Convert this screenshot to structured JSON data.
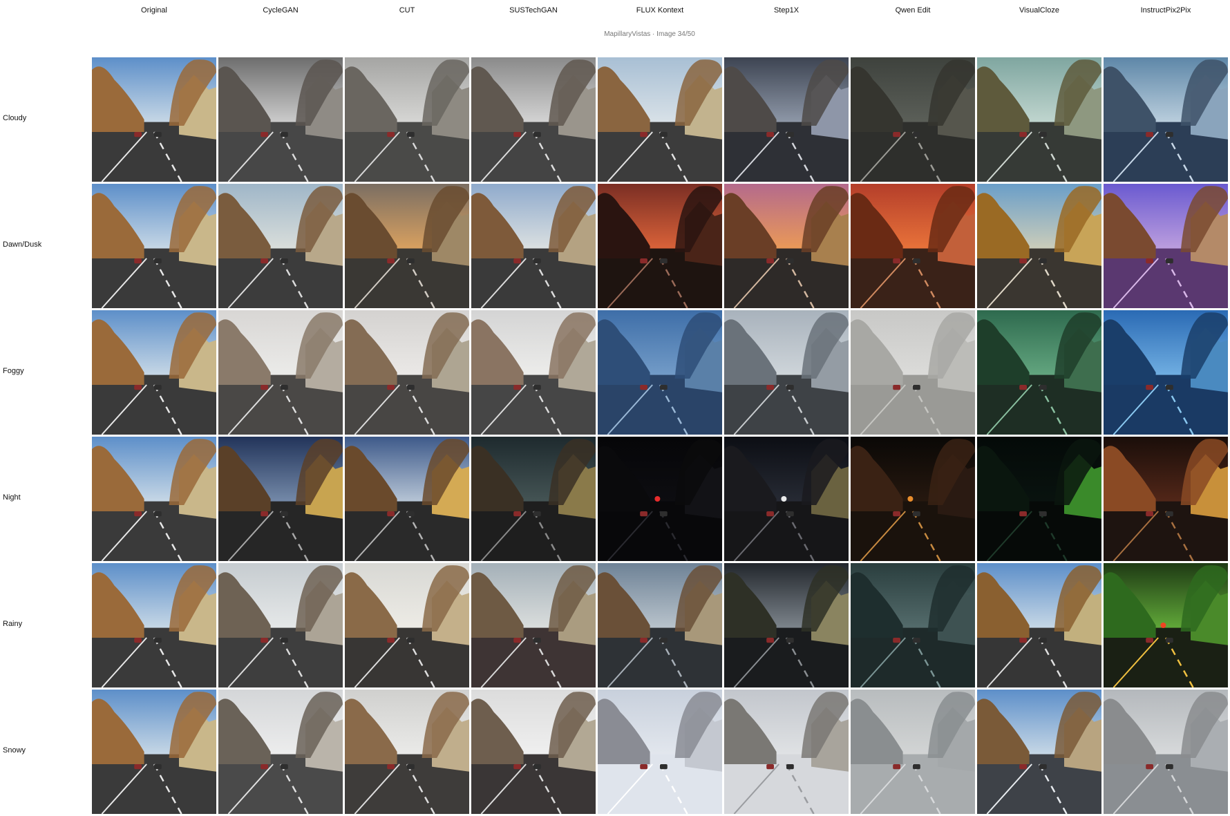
{
  "subtitle": "MapillaryVistas · Image 34/50",
  "columns": [
    {
      "label": "Original",
      "style": "orig"
    },
    {
      "label": "CycleGAN",
      "style": "cyclegan"
    },
    {
      "label": "CUT",
      "style": "cut"
    },
    {
      "label": "SUSTechGAN",
      "style": "sustech"
    },
    {
      "label": "FLUX Kontext",
      "style": "flux"
    },
    {
      "label": "Step1X",
      "style": "step1x"
    },
    {
      "label": "Qwen Edit",
      "style": "qwen"
    },
    {
      "label": "VisualCloze",
      "style": "visualcloze"
    },
    {
      "label": "InstructPix2Pix",
      "style": "ip2p"
    }
  ],
  "rows": [
    {
      "label": "Cloudy",
      "key": "cloudy"
    },
    {
      "label": "Dawn/Dusk",
      "key": "dusk"
    },
    {
      "label": "Foggy",
      "key": "foggy"
    },
    {
      "label": "Night",
      "key": "night"
    },
    {
      "label": "Rainy",
      "key": "rainy"
    },
    {
      "label": "Snowy",
      "key": "snowy"
    }
  ],
  "palettes": {
    "orig": {
      "sky1": "#5d8fc9",
      "sky2": "#d6e2ea",
      "tree": "#9a6a3a",
      "bld": "#c9b78a",
      "road": "#3a3a3a",
      "mark": "#e8e8e8",
      "light": ""
    }
  },
  "cell_palettes": {
    "cloudy": {
      "orig": {
        "sky1": "#5d8fc9",
        "sky2": "#d6e2ea",
        "tree": "#9a6a3a",
        "bld": "#c9b78a",
        "road": "#3a3a3a",
        "mark": "#e8e8e8"
      },
      "cyclegan": {
        "sky1": "#6d6d6d",
        "sky2": "#d9d9d9",
        "tree": "#5a5550",
        "bld": "#8f8b85",
        "road": "#474747",
        "mark": "#dcdcdc"
      },
      "cut": {
        "sky1": "#a5a5a3",
        "sky2": "#dddddb",
        "tree": "#6a6660",
        "bld": "#8e8a82",
        "road": "#4a4a48",
        "mark": "#d8d8d8"
      },
      "sustech": {
        "sky1": "#8a8a8a",
        "sky2": "#dedede",
        "tree": "#605850",
        "bld": "#9a958c",
        "road": "#444444",
        "mark": "#dddddd"
      },
      "flux": {
        "sky1": "#a8bfd4",
        "sky2": "#dfe6ea",
        "tree": "#8a6540",
        "bld": "#c2b38e",
        "road": "#3c3c3c",
        "mark": "#e4e4e4"
      },
      "step1x": {
        "sky1": "#3d4452",
        "sky2": "#9aa4b4",
        "tree": "#4e4a48",
        "bld": "#8e96a8",
        "road": "#2e3036",
        "mark": "#d4d6dc"
      },
      "qwen": {
        "sky1": "#3e423d",
        "sky2": "#5f635c",
        "tree": "#35352f",
        "bld": "#56564d",
        "road": "#2e2f2c",
        "mark": "#9c9c96"
      },
      "visualcloze": {
        "sky1": "#7fa6a0",
        "sky2": "#c9dcd5",
        "tree": "#5e5a3c",
        "bld": "#8e9880",
        "road": "#363a36",
        "mark": "#d0d8d2"
      },
      "ip2p": {
        "sky1": "#5e87a8",
        "sky2": "#c7d8e4",
        "tree": "#3e5268",
        "bld": "#8aa4bc",
        "road": "#2c3e56",
        "mark": "#c8d8e8"
      }
    },
    "dusk": {
      "orig": {
        "sky1": "#5d8fc9",
        "sky2": "#d6e2ea",
        "tree": "#9a6a3a",
        "bld": "#c9b78a",
        "road": "#3a3a3a",
        "mark": "#e8e8e8"
      },
      "cyclegan": {
        "sky1": "#9fb6c8",
        "sky2": "#e2e4de",
        "tree": "#7a5c3e",
        "bld": "#b8a88a",
        "road": "#3c3c3c",
        "mark": "#dcdcdc"
      },
      "cut": {
        "sky1": "#7a6e62",
        "sky2": "#e6a860",
        "tree": "#6a4c30",
        "bld": "#9e8866",
        "road": "#3a3834",
        "mark": "#d2ccc4"
      },
      "sustech": {
        "sky1": "#8faacc",
        "sky2": "#e6e8e4",
        "tree": "#7e5a3a",
        "bld": "#b4a282",
        "road": "#3a3a3a",
        "mark": "#dcdcdc"
      },
      "flux": {
        "sky1": "#7a2e24",
        "sky2": "#e86a3c",
        "tree": "#2a1410",
        "bld": "#4a2418",
        "road": "#1e1410",
        "mark": "#9a6a58"
      },
      "step1x": {
        "sky1": "#b46a8c",
        "sky2": "#f2a050",
        "tree": "#6a3e26",
        "bld": "#a8804e",
        "road": "#2e2a28",
        "mark": "#d4b8a0"
      },
      "qwen": {
        "sky1": "#b43e2a",
        "sky2": "#f07a3c",
        "tree": "#6a2a14",
        "bld": "#c2603a",
        "road": "#3a2218",
        "mark": "#d08a60"
      },
      "visualcloze": {
        "sky1": "#6a9ec8",
        "sky2": "#dad4b8",
        "tree": "#9a6a24",
        "bld": "#c8a458",
        "road": "#3a3630",
        "mark": "#e0d8c8"
      },
      "ip2p": {
        "sky1": "#6a5ad0",
        "sky2": "#c8a8e0",
        "tree": "#7a4a30",
        "bld": "#b48a68",
        "road": "#5a3870",
        "mark": "#d8b8e8"
      }
    },
    "foggy": {
      "orig": {
        "sky1": "#5d8fc9",
        "sky2": "#d6e2ea",
        "tree": "#9a6a3a",
        "bld": "#c9b78a",
        "road": "#3a3a3a",
        "mark": "#e8e8e8"
      },
      "cyclegan": {
        "sky1": "#d8d6d4",
        "sky2": "#eeeeec",
        "tree": "#8a7a6a",
        "bld": "#b4aca0",
        "road": "#4a4846",
        "mark": "#dedede"
      },
      "cut": {
        "sky1": "#d4d2d0",
        "sky2": "#eeecea",
        "tree": "#846c54",
        "bld": "#aea592",
        "road": "#484644",
        "mark": "#dcdcdc"
      },
      "sustech": {
        "sky1": "#d4d4d4",
        "sky2": "#f0f0ee",
        "tree": "#8a7462",
        "bld": "#b0a898",
        "road": "#464646",
        "mark": "#dcdcdc"
      },
      "flux": {
        "sky1": "#3e6ea8",
        "sky2": "#7aa2cc",
        "tree": "#2e4e78",
        "bld": "#5a80a8",
        "road": "#2a4468",
        "mark": "#9ab8d6"
      },
      "step1x": {
        "sky1": "#a8b2bc",
        "sky2": "#d4dade",
        "tree": "#6a727a",
        "bld": "#949ca4",
        "road": "#3e4246",
        "mark": "#c8cccf"
      },
      "qwen": {
        "sky1": "#c8c8c6",
        "sky2": "#dededc",
        "tree": "#a8a8a4",
        "bld": "#bcbcb8",
        "road": "#9a9a96",
        "mark": "#c6c6c2"
      },
      "visualcloze": {
        "sky1": "#2e6a4e",
        "sky2": "#6aae86",
        "tree": "#1e3e2a",
        "bld": "#3e6e4e",
        "road": "#1e2e24",
        "mark": "#8ac0a0"
      },
      "ip2p": {
        "sky1": "#2a6ab4",
        "sky2": "#7ab8e8",
        "tree": "#1a3e6a",
        "bld": "#4a8ac0",
        "road": "#1a3a64",
        "mark": "#8ac8f0"
      }
    },
    "night": {
      "orig": {
        "sky1": "#5d8fc9",
        "sky2": "#d6e2ea",
        "tree": "#9a6a3a",
        "bld": "#c9b78a",
        "road": "#3a3a3a",
        "mark": "#e8e8e8"
      },
      "cyclegan": {
        "sky1": "#22345a",
        "sky2": "#8096b4",
        "tree": "#5a4028",
        "bld": "#c8a450",
        "road": "#262626",
        "mark": "#a8a8a8"
      },
      "cut": {
        "sky1": "#3e5a8a",
        "sky2": "#c8d4e0",
        "tree": "#6a4a2c",
        "bld": "#d4aa54",
        "road": "#2a2a2a",
        "mark": "#b4b4b4"
      },
      "sustech": {
        "sky1": "#1e2a2e",
        "sky2": "#4a5a5a",
        "tree": "#3a3024",
        "bld": "#8a7a4a",
        "road": "#1e1e1e",
        "mark": "#8a8a8a"
      },
      "flux": {
        "sky1": "#060608",
        "sky2": "#0e0e12",
        "tree": "#0a0a0c",
        "bld": "#121216",
        "road": "#08080a",
        "mark": "#2a2a30",
        "light": "#ff3030"
      },
      "step1x": {
        "sky1": "#0c0e14",
        "sky2": "#2a2e38",
        "tree": "#1a1a1e",
        "bld": "#6a6240",
        "road": "#161618",
        "mark": "#6a6a70",
        "light": "#ffffff"
      },
      "qwen": {
        "sky1": "#0a0806",
        "sky2": "#2a1a10",
        "tree": "#3a2214",
        "bld": "#2a1a12",
        "road": "#1a120c",
        "mark": "#c88a40",
        "light": "#ff9a30"
      },
      "visualcloze": {
        "sky1": "#040a08",
        "sky2": "#0a1410",
        "tree": "#0a160e",
        "bld": "#3a8a2a",
        "road": "#060a08",
        "mark": "#1e3a2a"
      },
      "ip2p": {
        "sky1": "#1a0e0a",
        "sky2": "#5a2a1a",
        "tree": "#8a4a24",
        "bld": "#c8903a",
        "road": "#1e1410",
        "mark": "#a87040"
      }
    },
    "rainy": {
      "orig": {
        "sky1": "#5d8fc9",
        "sky2": "#d6e2ea",
        "tree": "#9a6a3a",
        "bld": "#c9b78a",
        "road": "#3a3a3a",
        "mark": "#e8e8e8"
      },
      "cyclegan": {
        "sky1": "#c6ccd0",
        "sky2": "#eaecec",
        "tree": "#6e6254",
        "bld": "#aca496",
        "road": "#3e3e3e",
        "mark": "#dcdcdc"
      },
      "cut": {
        "sky1": "#d8d8d4",
        "sky2": "#f0eee8",
        "tree": "#8a6a48",
        "bld": "#c4b08a",
        "road": "#383634",
        "mark": "#dedede"
      },
      "sustech": {
        "sky1": "#a4b0b8",
        "sky2": "#e2e4e2",
        "tree": "#6e5a44",
        "bld": "#aa9c80",
        "road": "#3e3434",
        "mark": "#d8d8d8"
      },
      "flux": {
        "sky1": "#6e8296",
        "sky2": "#c4cdd4",
        "tree": "#6a5038",
        "bld": "#a8987a",
        "road": "#2e3236",
        "mark": "#a8b0b8"
      },
      "step1x": {
        "sky1": "#22262c",
        "sky2": "#8a929a",
        "tree": "#2e3026",
        "bld": "#8a8460",
        "road": "#1a1c1e",
        "mark": "#8a8e92"
      },
      "qwen": {
        "sky1": "#2a3e3e",
        "sky2": "#5a7272",
        "tree": "#1e2e2e",
        "bld": "#3e5252",
        "road": "#1e2a2a",
        "mark": "#7a9494"
      },
      "visualcloze": {
        "sky1": "#5d8fc9",
        "sky2": "#d6e2ea",
        "tree": "#8a6030",
        "bld": "#c2b07e",
        "road": "#363636",
        "mark": "#e0e0e0"
      },
      "ip2p": {
        "sky1": "#1e3a14",
        "sky2": "#6ab83e",
        "tree": "#2e6a1e",
        "bld": "#4a8a2a",
        "road": "#1a2014",
        "mark": "#f0c040",
        "light": "#ff3a20"
      }
    },
    "snowy": {
      "orig": {
        "sky1": "#5d8fc9",
        "sky2": "#d6e2ea",
        "tree": "#9a6a3a",
        "bld": "#c9b78a",
        "road": "#3a3a3a",
        "mark": "#e8e8e8"
      },
      "cyclegan": {
        "sky1": "#d4d6d8",
        "sky2": "#f0f0f0",
        "tree": "#6a6258",
        "bld": "#bab4aa",
        "road": "#4a4a4a",
        "mark": "#e0e0e0"
      },
      "cut": {
        "sky1": "#d0d0ce",
        "sky2": "#eeeeec",
        "tree": "#8a6a4a",
        "bld": "#c0ae8c",
        "road": "#3e3c3a",
        "mark": "#dedede"
      },
      "sustech": {
        "sky1": "#dcdcdc",
        "sky2": "#f2f2f2",
        "tree": "#6e5e4e",
        "bld": "#b2a894",
        "road": "#3a3636",
        "mark": "#dcdcdc"
      },
      "flux": {
        "sky1": "#c8d0dc",
        "sky2": "#e6eaf0",
        "tree": "#8a8c94",
        "bld": "#c4c8d0",
        "road": "#dfe4ec",
        "mark": "#ffffff"
      },
      "step1x": {
        "sky1": "#c2c6cc",
        "sky2": "#e4e6e8",
        "tree": "#7a7874",
        "bld": "#a8a49c",
        "road": "#d6d8dc",
        "mark": "#9a9ca0"
      },
      "qwen": {
        "sky1": "#b8bcbe",
        "sky2": "#d6d8d8",
        "tree": "#8a8e90",
        "bld": "#a4a8aa",
        "road": "#a8acae",
        "mark": "#d8dadc"
      },
      "visualcloze": {
        "sky1": "#5d8fc9",
        "sky2": "#d6e2ea",
        "tree": "#7a5a38",
        "bld": "#b8a480",
        "road": "#3e4248",
        "mark": "#e8ecf0"
      },
      "ip2p": {
        "sky1": "#b4b8bc",
        "sky2": "#dcdedf",
        "tree": "#8a8c8e",
        "bld": "#aaaeb2",
        "road": "#8a8e92",
        "mark": "#d4d6d8"
      }
    }
  }
}
